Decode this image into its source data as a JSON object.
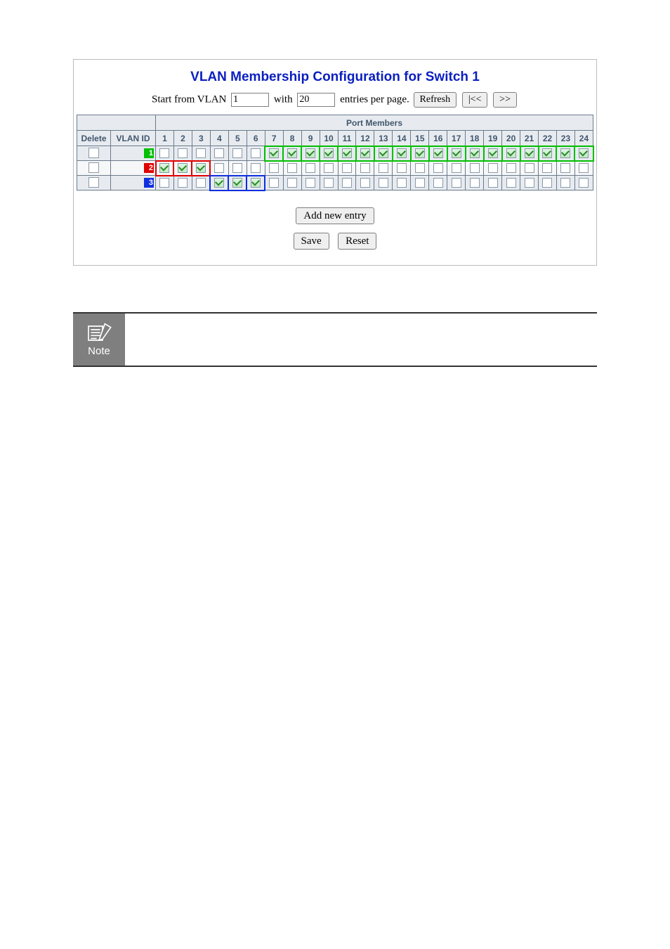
{
  "title": "VLAN Membership Configuration for Switch 1",
  "controls": {
    "start_label": "Start from VLAN",
    "start_value": "1",
    "with_label": "with",
    "entries_value": "20",
    "entries_label": "entries per page.",
    "refresh": "Refresh",
    "prev": "|<<",
    "next": ">>"
  },
  "headers": {
    "port_members": "Port Members",
    "delete": "Delete",
    "vlan_id": "VLAN ID"
  },
  "ports": [
    "1",
    "2",
    "3",
    "4",
    "5",
    "6",
    "7",
    "8",
    "9",
    "10",
    "11",
    "12",
    "13",
    "14",
    "15",
    "16",
    "17",
    "18",
    "19",
    "20",
    "21",
    "22",
    "23",
    "24"
  ],
  "rows": [
    {
      "id": "1",
      "id_color": "#00c000",
      "delete": false,
      "members": [
        false,
        false,
        false,
        false,
        false,
        false,
        true,
        true,
        true,
        true,
        true,
        true,
        true,
        true,
        true,
        true,
        true,
        true,
        true,
        true,
        true,
        true,
        true,
        true
      ],
      "highlight": {
        "color": "#00c000",
        "from": 7,
        "to": 24
      }
    },
    {
      "id": "2",
      "id_color": "#e00000",
      "delete": false,
      "members": [
        true,
        true,
        true,
        false,
        false,
        false,
        false,
        false,
        false,
        false,
        false,
        false,
        false,
        false,
        false,
        false,
        false,
        false,
        false,
        false,
        false,
        false,
        false,
        false
      ],
      "highlight": {
        "color": "#e00000",
        "from": 1,
        "to": 3
      }
    },
    {
      "id": "3",
      "id_color": "#1030e0",
      "delete": false,
      "members": [
        false,
        false,
        false,
        true,
        true,
        true,
        false,
        false,
        false,
        false,
        false,
        false,
        false,
        false,
        false,
        false,
        false,
        false,
        false,
        false,
        false,
        false,
        false,
        false
      ],
      "highlight": {
        "color": "#1030e0",
        "from": 4,
        "to": 6
      }
    }
  ],
  "buttons": {
    "add": "Add new entry",
    "save": "Save",
    "reset": "Reset"
  },
  "note": {
    "label": "Note"
  }
}
